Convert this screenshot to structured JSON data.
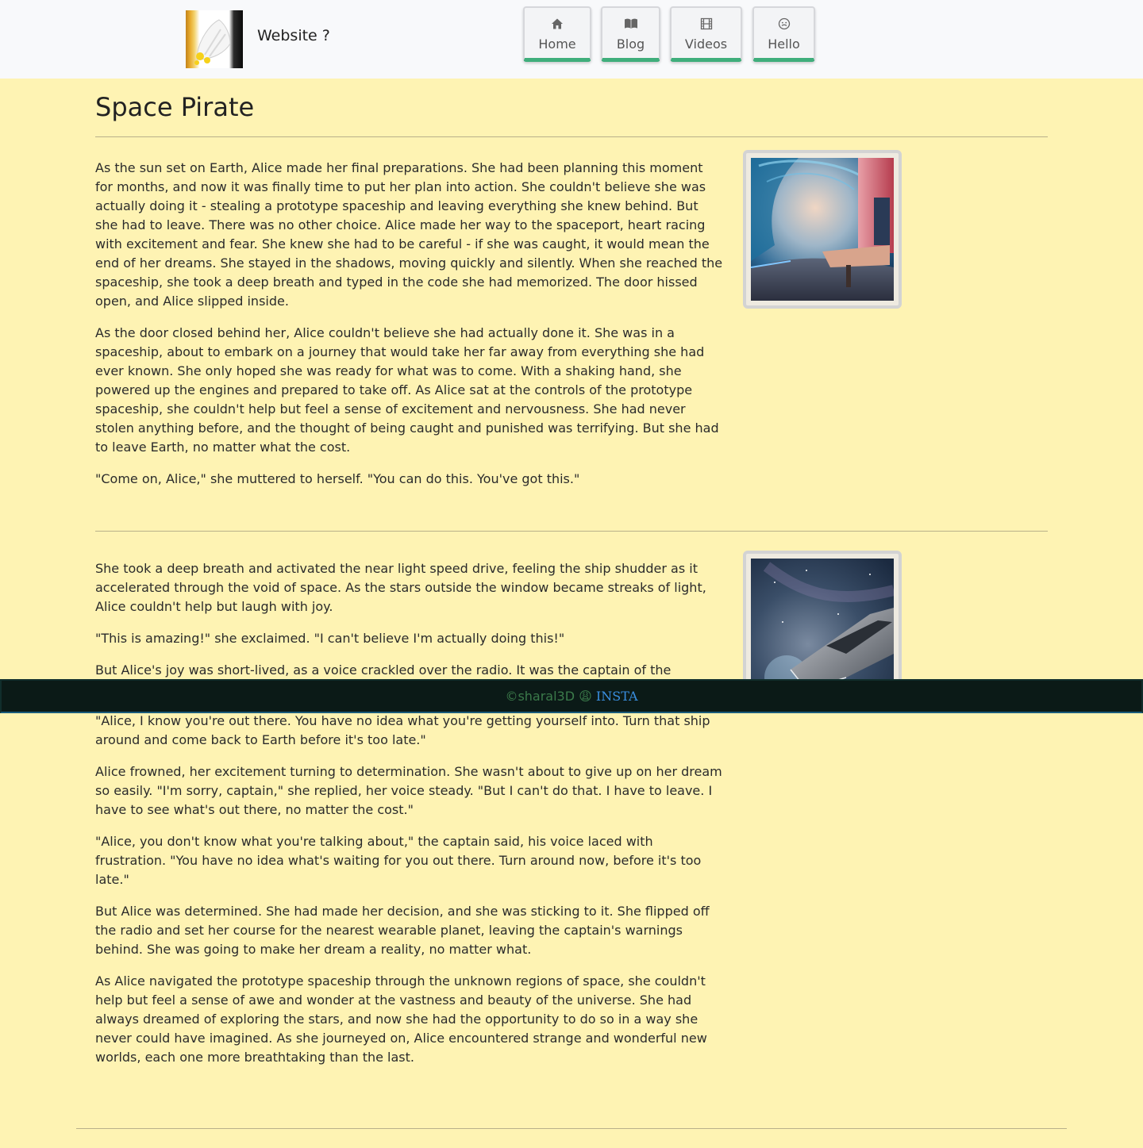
{
  "brand": {
    "name": "Website ?"
  },
  "nav": [
    {
      "label": "Home"
    },
    {
      "label": "Blog"
    },
    {
      "label": "Videos"
    },
    {
      "label": "Hello"
    }
  ],
  "article": {
    "title": "Space Pirate",
    "sections": [
      {
        "paragraphs": [
          "As the sun set on Earth, Alice made her final preparations. She had been planning this moment for months, and now it was finally time to put her plan into action. She couldn't believe she was actually doing it - stealing a prototype spaceship and leaving everything she knew behind. But she had to leave. There was no other choice. Alice made her way to the spaceport, heart racing with excitement and fear. She knew she had to be careful - if she was caught, it would mean the end of her dreams. She stayed in the shadows, moving quickly and silently. When she reached the spaceship, she took a deep breath and typed in the code she had memorized. The door hissed open, and Alice slipped inside.",
          "As the door closed behind her, Alice couldn't believe she had actually done it. She was in a spaceship, about to embark on a journey that would take her far away from everything she had ever known. She only hoped she was ready for what was to come. With a shaking hand, she powered up the engines and prepared to take off. As Alice sat at the controls of the prototype spaceship, she couldn't help but feel a sense of excitement and nervousness. She had never stolen anything before, and the thought of being caught and punished was terrifying. But she had to leave Earth, no matter what the cost.",
          "\"Come on, Alice,\" she muttered to herself. \"You can do this. You've got this.\""
        ]
      },
      {
        "paragraphs": [
          "She took a deep breath and activated the near light speed drive, feeling the ship shudder as it accelerated through the void of space. As the stars outside the window became streaks of light, Alice couldn't help but laugh with joy.",
          "\"This is amazing!\" she exclaimed. \"I can't believe I'm actually doing this!\"",
          "But Alice's joy was short-lived, as a voice crackled over the radio. It was the captain of the",
          "\"Alice, I know you're out there. You have no idea what you're getting yourself into. Turn that ship around and come back to Earth before it's too late.\"",
          "Alice frowned, her excitement turning to determination. She wasn't about to give up on her dream so easily. \"I'm sorry, captain,\" she replied, her voice steady. \"But I can't do that. I have to leave. I have to see what's out there, no matter the cost.\"",
          "\"Alice, you don't know what you're talking about,\" the captain said, his voice laced with frustration. \"You have no idea what's waiting for you out there. Turn around now, before it's too late.\"",
          "But Alice was determined. She had made her decision, and she was sticking to it. She flipped off the radio and set her course for the nearest wearable planet, leaving the captain's warnings behind. She was going to make her dream a reality, no matter what.",
          "As Alice navigated the prototype spaceship through the unknown regions of space, she couldn't help but feel a sense of awe and wonder at the vastness and beauty of the universe. She had always dreamed of exploring the stars, and now she had the opportunity to do so in a way she never could have imagined. As she journeyed on, Alice encountered strange and wonderful new worlds, each one more breathtaking than the last."
        ]
      }
    ]
  },
  "footer": {
    "copyright": "©sharal3D 😩",
    "link": "INSTA"
  },
  "colors": {
    "background": "#fef3b3",
    "navbar": "#f8f9fb",
    "nav_accent": "#3fae7b",
    "footer": "#0b1a17",
    "link": "#3a8fe0"
  },
  "icons": {
    "home": "home-icon",
    "blog": "book-icon",
    "videos": "film-icon",
    "hello": "smile-icon"
  }
}
